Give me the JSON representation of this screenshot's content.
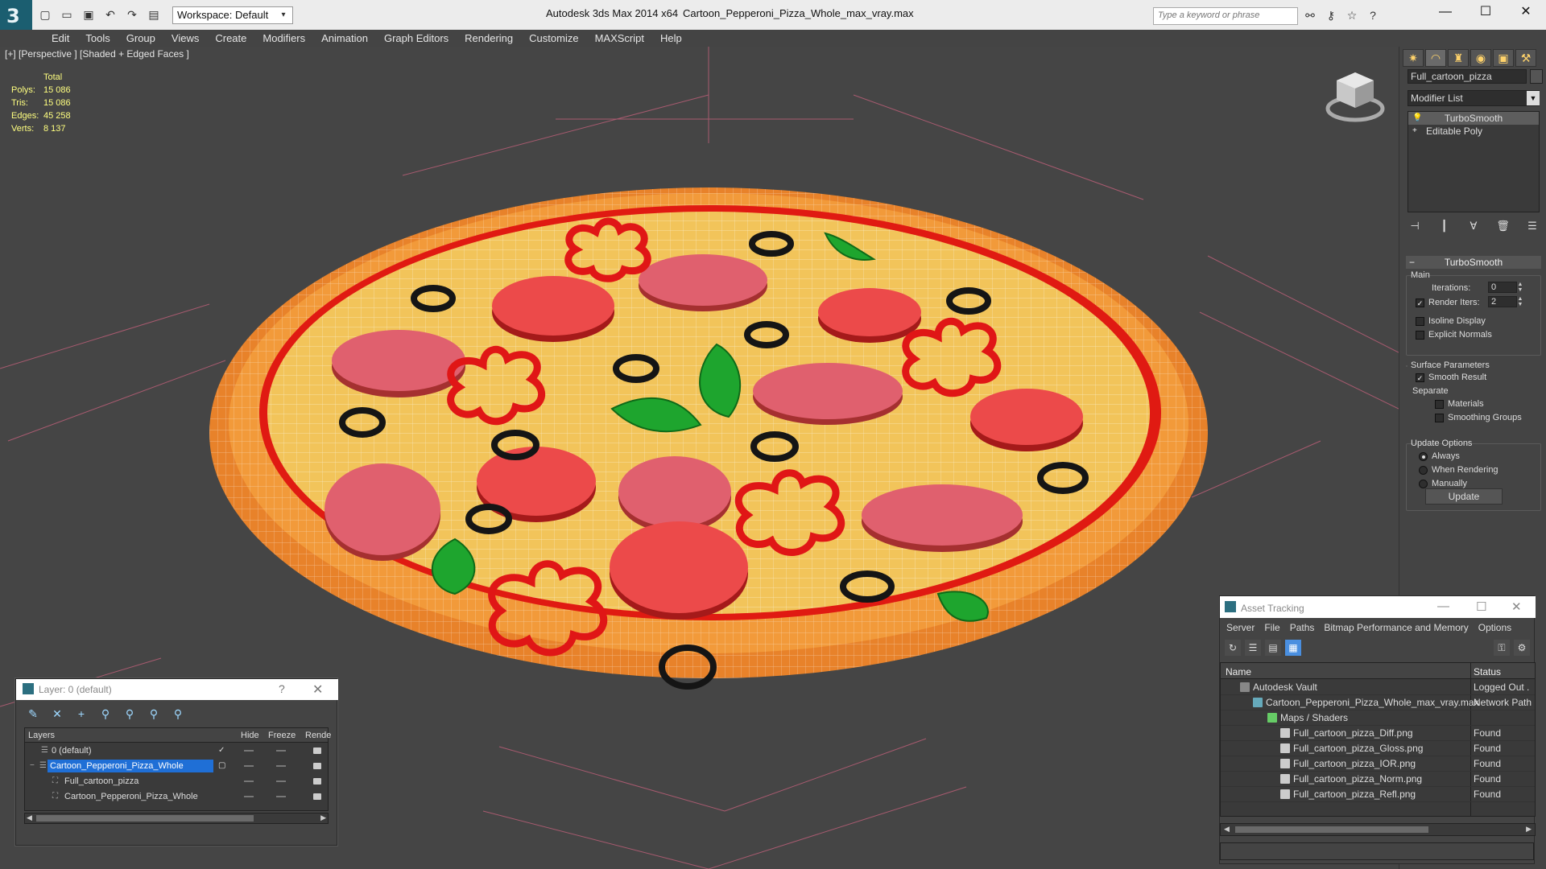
{
  "titlebar": {
    "workspace": "Workspace: Default",
    "app_title": "Autodesk 3ds Max  2014 x64",
    "file_title": "Cartoon_Pepperoni_Pizza_Whole_max_vray.max",
    "search_placeholder": "Type a keyword or phrase"
  },
  "menu": [
    "Edit",
    "Tools",
    "Group",
    "Views",
    "Create",
    "Modifiers",
    "Animation",
    "Graph Editors",
    "Rendering",
    "Customize",
    "MAXScript",
    "Help"
  ],
  "viewport": {
    "label": "[+] [Perspective ] [Shaded + Edged Faces ]",
    "stats": {
      "header": "Total",
      "rows": [
        {
          "k": "Polys:",
          "v": "15 086"
        },
        {
          "k": "Tris:",
          "v": "15 086"
        },
        {
          "k": "Edges:",
          "v": "45 258"
        },
        {
          "k": "Verts:",
          "v": "8 137"
        }
      ]
    }
  },
  "command_panel": {
    "object_name": "Full_cartoon_pizza",
    "modifier_list": "Modifier List",
    "stack": [
      "TurboSmooth",
      "Editable Poly"
    ],
    "rollout_title": "TurboSmooth",
    "main_label": "Main",
    "iterations_label": "Iterations:",
    "iterations_value": "0",
    "render_iters_label": "Render Iters:",
    "render_iters_value": "2",
    "isoline_label": "Isoline Display",
    "explicit_label": "Explicit Normals",
    "surface_label": "Surface Parameters",
    "smooth_label": "Smooth Result",
    "separate_label": "Separate",
    "materials_label": "Materials",
    "smoothing_label": "Smoothing Groups",
    "update_options_label": "Update Options",
    "always_label": "Always",
    "when_rendering_label": "When Rendering",
    "manually_label": "Manually",
    "update_button": "Update"
  },
  "layer_window": {
    "title": "Layer: 0 (default)",
    "col_layers": "Layers",
    "col_hide": "Hide",
    "col_freeze": "Freeze",
    "col_render": "Rende",
    "rows": [
      {
        "name": "0 (default)"
      },
      {
        "name": "Cartoon_Pepperoni_Pizza_Whole"
      },
      {
        "name": "Full_cartoon_pizza"
      },
      {
        "name": "Cartoon_Pepperoni_Pizza_Whole"
      }
    ]
  },
  "asset_window": {
    "title": "Asset Tracking",
    "menu": [
      "Server",
      "File",
      "Paths",
      "Bitmap Performance and Memory",
      "Options"
    ],
    "col_name": "Name",
    "col_status": "Status",
    "rows": [
      {
        "name": "Autodesk Vault",
        "status": "Logged Out ."
      },
      {
        "name": "Cartoon_Pepperoni_Pizza_Whole_max_vray.max",
        "status": "Network Path"
      },
      {
        "name": "Maps / Shaders",
        "status": ""
      },
      {
        "name": "Full_cartoon_pizza_Diff.png",
        "status": "Found"
      },
      {
        "name": "Full_cartoon_pizza_Gloss.png",
        "status": "Found"
      },
      {
        "name": "Full_cartoon_pizza_IOR.png",
        "status": "Found"
      },
      {
        "name": "Full_cartoon_pizza_Norm.png",
        "status": "Found"
      },
      {
        "name": "Full_cartoon_pizza_Refl.png",
        "status": "Found"
      }
    ]
  },
  "colors": {
    "viewport_bg": "#454545",
    "grid_line": "#c0607a",
    "crust": "#e8822a",
    "cheese": "#f2c45a",
    "pepperoni": "#d9474f",
    "pepper": "#e01616",
    "basil": "#1ea52e",
    "olive": "#151515",
    "selection": "#1f6fd6"
  }
}
